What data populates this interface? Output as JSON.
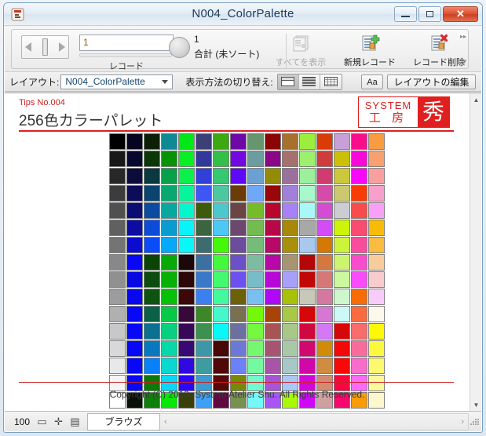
{
  "window": {
    "title": "N004_ColorPalette",
    "app_icon": "filemaker-app-icon",
    "minimize_label": "",
    "maximize_label": "",
    "close_label": "✕"
  },
  "toolbar": {
    "record_input_value": "1",
    "record_label": "レコード",
    "total_count": "1",
    "total_label": "合計 (未ソート)",
    "show_all_label": "すべてを表示",
    "new_record_label": "新規レコード",
    "delete_record_label": "レコード削除",
    "prev_icon": "triangle-left-icon",
    "next_icon": "triangle-right-icon",
    "dial_icon": "record-slider-handle-icon",
    "pie_icon": "found-set-pie-icon",
    "show_all_icon": "show-all-records-icon",
    "new_record_icon": "new-record-icon",
    "delete_record_icon": "delete-record-icon"
  },
  "layoutbar": {
    "layout_label": "レイアウト:",
    "layout_value": "N004_ColorPalette",
    "view_label": "表示方法の切り替え:",
    "view_form_icon": "form-view-icon",
    "view_list_icon": "list-view-icon",
    "view_table_icon": "table-view-icon",
    "active_view": "form",
    "text_format_label": "Aa",
    "edit_layout_label": "レイアウトの編集"
  },
  "content": {
    "tips_label": "Tips No.004",
    "headline": "256色カラーパレット",
    "logo_system": "SYSTEM",
    "logo_kobo": "工 房",
    "logo_shu": "秀",
    "copyright": "Copyright (C) 2013- System Atelier Shu. All Rights Reserved."
  },
  "statusbar": {
    "zoom_value": "100",
    "zoom_out_icon": "zoom-out-icon",
    "zoom_in_icon": "zoom-in-icon",
    "toggle_window_icon": "toggle-window-icon",
    "mode_label": "ブラウズ",
    "scroll_left_icon": "chevron-left-icon",
    "scroll_right_icon": "chevron-right-icon",
    "resize_grip_icon": "resize-grip-icon"
  },
  "colors": {
    "accent_red": "#e01f1f",
    "title_blue": "#1b3a5c",
    "close_red": "#dd5232"
  },
  "chart_data": {
    "type": "table",
    "title": "256色カラーパレット",
    "rows": 16,
    "cols": 16,
    "swatches": [
      [
        "#000000",
        "#050520",
        "#0c2008",
        "#0f8a94",
        "#00e818",
        "#3c4076",
        "#3ca812",
        "#6e09a8",
        "#67956e",
        "#8c0505",
        "#a8702e",
        "#9cee3c",
        "#d93c06",
        "#c8a0d8",
        "#f80e8c",
        "#f79c40"
      ],
      [
        "#181818",
        "#08082e",
        "#0c3808",
        "#069406",
        "#08f024",
        "#33399c",
        "#34c048",
        "#7408e0",
        "#6a9ca0",
        "#8c0688",
        "#a8706c",
        "#9cf06c",
        "#d03c3c",
        "#ccc006",
        "#f808d8",
        "#f8a070"
      ],
      [
        "#282828",
        "#0c0c3c",
        "#0c3840",
        "#08a048",
        "#0cf04c",
        "#3340d8",
        "#34c870",
        "#6008f8",
        "#6ca0d0",
        "#948c06",
        "#9c709c",
        "#9cf09c",
        "#d03c70",
        "#ccc83c",
        "#f808f8",
        "#f8a0a0"
      ],
      [
        "#3c3c3c",
        "#0c0c58",
        "#0c4470",
        "#08a870",
        "#08f49c",
        "#3c56f8",
        "#4cc8a0",
        "#6c3c08",
        "#70a8f8",
        "#980808",
        "#a080d8",
        "#a8f8cc",
        "#d44ca8",
        "#ccc870",
        "#f83c08",
        "#f8a0cc"
      ],
      [
        "#505050",
        "#0c0c74",
        "#0c4ca0",
        "#08a8a0",
        "#08f4cc",
        "#3c5c0c",
        "#4cc8cc",
        "#6c4444",
        "#74bc28",
        "#b80830",
        "#a880f8",
        "#a8f8f8",
        "#d44cd4",
        "#ccccd4",
        "#f84c4c",
        "#f8a0f8"
      ],
      [
        "#606060",
        "#0c0ca0",
        "#0c4cd8",
        "#089cd0",
        "#08f4f8",
        "#3c6440",
        "#4cc8f8",
        "#6c4870",
        "#74bc50",
        "#b80848",
        "#a88808",
        "#a8a8a8",
        "#d44cf8",
        "#ccf408",
        "#f84c70",
        "#f8bc08"
      ],
      [
        "#747474",
        "#0c0cd0",
        "#0c4cf8",
        "#08a8f8",
        "#08f8f8",
        "#3c6c70",
        "#44f808",
        "#6c4c9c",
        "#74bc78",
        "#b80868",
        "#a8900c",
        "#a8c8f0",
        "#d47808",
        "#ccf43c",
        "#f84c9c",
        "#f8bc40"
      ],
      [
        "#888888",
        "#0808f8",
        "#0c4408",
        "#08a808",
        "#1c0808",
        "#3c70a0",
        "#44f83c",
        "#6c50c8",
        "#7cbca0",
        "#b808a8",
        "#a89470",
        "#b40808",
        "#d47840",
        "#ccf470",
        "#f84ccc",
        "#f8cc9c"
      ],
      [
        "#909090",
        "#0808e0",
        "#0c4c10",
        "#08b008",
        "#2c0808",
        "#3c78c8",
        "#44f870",
        "#6c50f0",
        "#78bcc8",
        "#b808d8",
        "#a8a0f8",
        "#c00808",
        "#d47878",
        "#ccf8a0",
        "#f84cf8",
        "#f8cccc"
      ],
      [
        "#9c9c9c",
        "#0808f0",
        "#0c5410",
        "#08c008",
        "#3c0808",
        "#3c80f0",
        "#44f8a0",
        "#6c6008",
        "#78c0f0",
        "#b008f8",
        "#a8c008",
        "#c8c8b8",
        "#d478a0",
        "#ccf8cc",
        "#f86c08",
        "#f8ccf8"
      ],
      [
        "#b0b0b0",
        "#0808f8",
        "#0c6048",
        "#08c848",
        "#380838",
        "#3c8828",
        "#44f8cc",
        "#787050",
        "#74f808",
        "#a84408",
        "#a8c848",
        "#d40808",
        "#d478d4",
        "#ccf8f8",
        "#f86c40",
        "#fcf8ec"
      ],
      [
        "#c8c8c8",
        "#0808f8",
        "#0c7090",
        "#08d080",
        "#380858",
        "#3c9050",
        "#08f8f8",
        "#6c70a0",
        "#74f840",
        "#a85454",
        "#a8c888",
        "#d00840",
        "#d478f8",
        "#d40808",
        "#f86c6c",
        "#fcf808"
      ],
      [
        "#d8d8d8",
        "#0808f8",
        "#0878c0",
        "#08d8a8",
        "#380874",
        "#3c98a8",
        "#480808",
        "#6c78d8",
        "#74f870",
        "#a85470",
        "#a8c8a8",
        "#d00870",
        "#d08c08",
        "#f40808",
        "#f86c9c",
        "#fcf840"
      ],
      [
        "#e8e8e8",
        "#0808f8",
        "#0880f8",
        "#08d8d0",
        "#3008e0",
        "#3c9ca0",
        "#500808",
        "#6c80f8",
        "#74f8a0",
        "#a854a8",
        "#a8c8c8",
        "#d008a8",
        "#d08c40",
        "#f80808",
        "#f86ccc",
        "#fcf870"
      ],
      [
        "#f4f4f4",
        "#0808f8",
        "#0c7808",
        "#08d8f8",
        "#2c08f8",
        "#3c9cd0",
        "#580808",
        "#788808",
        "#74f8cc",
        "#a854d8",
        "#a8c8f8",
        "#d008d8",
        "#d08c70",
        "#f80840",
        "#f86cf8",
        "#fcf89c"
      ],
      [
        "#ffffff",
        "#081008",
        "#0c8008",
        "#08e808",
        "#384008",
        "#3ca0f8",
        "#600840",
        "#789050",
        "#74f8f8",
        "#a854f8",
        "#a8f808",
        "#d008f8",
        "#d0a0a0",
        "#f8086c",
        "#f89c08",
        "#fcf8cc"
      ]
    ]
  }
}
